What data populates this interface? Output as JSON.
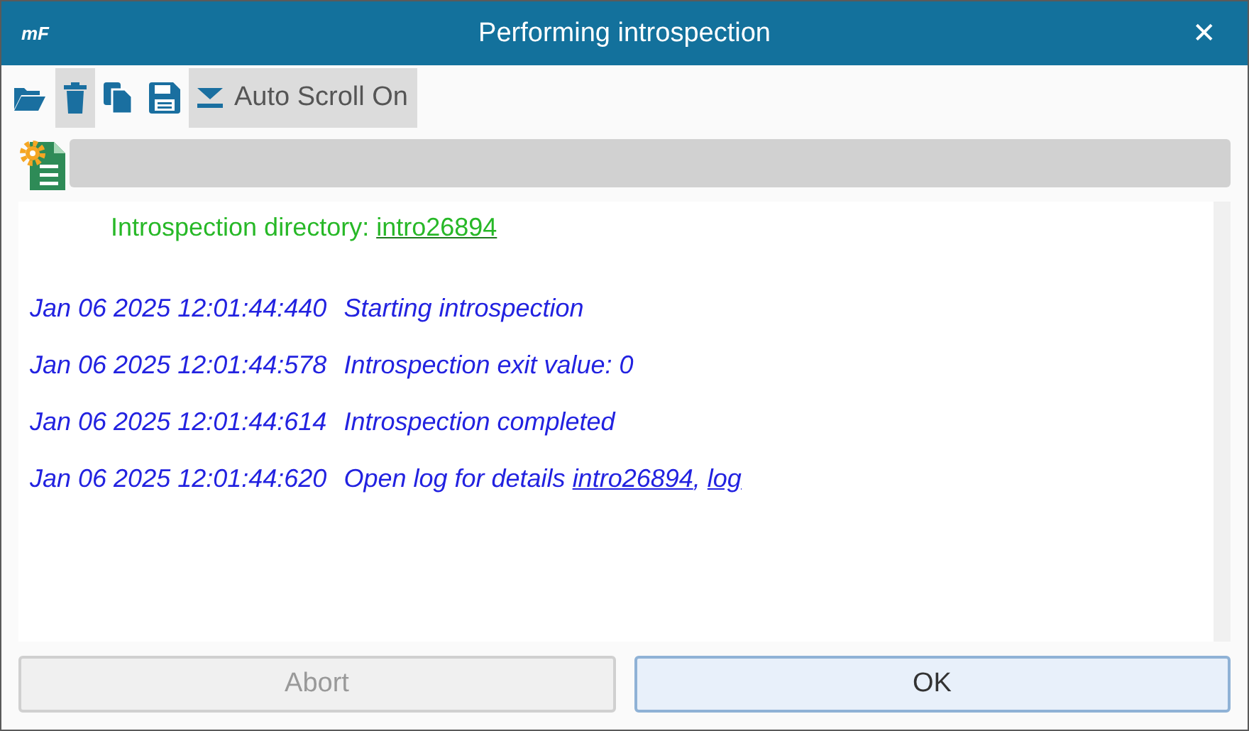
{
  "window": {
    "logo": "mF",
    "title": "Performing introspection",
    "close": "✕"
  },
  "toolbar": [
    {
      "kind": "open",
      "active": false
    },
    {
      "kind": "delete",
      "active": true
    },
    {
      "kind": "copy",
      "active": false
    },
    {
      "kind": "save",
      "active": false
    },
    {
      "kind": "autoscroll",
      "active": true,
      "label": "Auto Scroll On"
    }
  ],
  "directory": {
    "label": "Introspection directory: ",
    "link": "intro26894"
  },
  "log": [
    {
      "time": "Jan 06 2025 12:01:44:440",
      "text": "Starting introspection"
    },
    {
      "time": "Jan 06 2025 12:01:44:578",
      "text": "Introspection exit value: 0"
    },
    {
      "time": "Jan 06 2025 12:01:44:614",
      "text": "Introspection completed"
    },
    {
      "time": "Jan 06 2025 12:01:44:620",
      "text": "Open log for details ",
      "links": [
        "intro26894",
        "log"
      ],
      "link_separator": ", "
    }
  ],
  "buttons": [
    {
      "label": "Abort",
      "disabled": true,
      "default": false
    },
    {
      "label": "OK",
      "disabled": false,
      "default": true
    }
  ]
}
